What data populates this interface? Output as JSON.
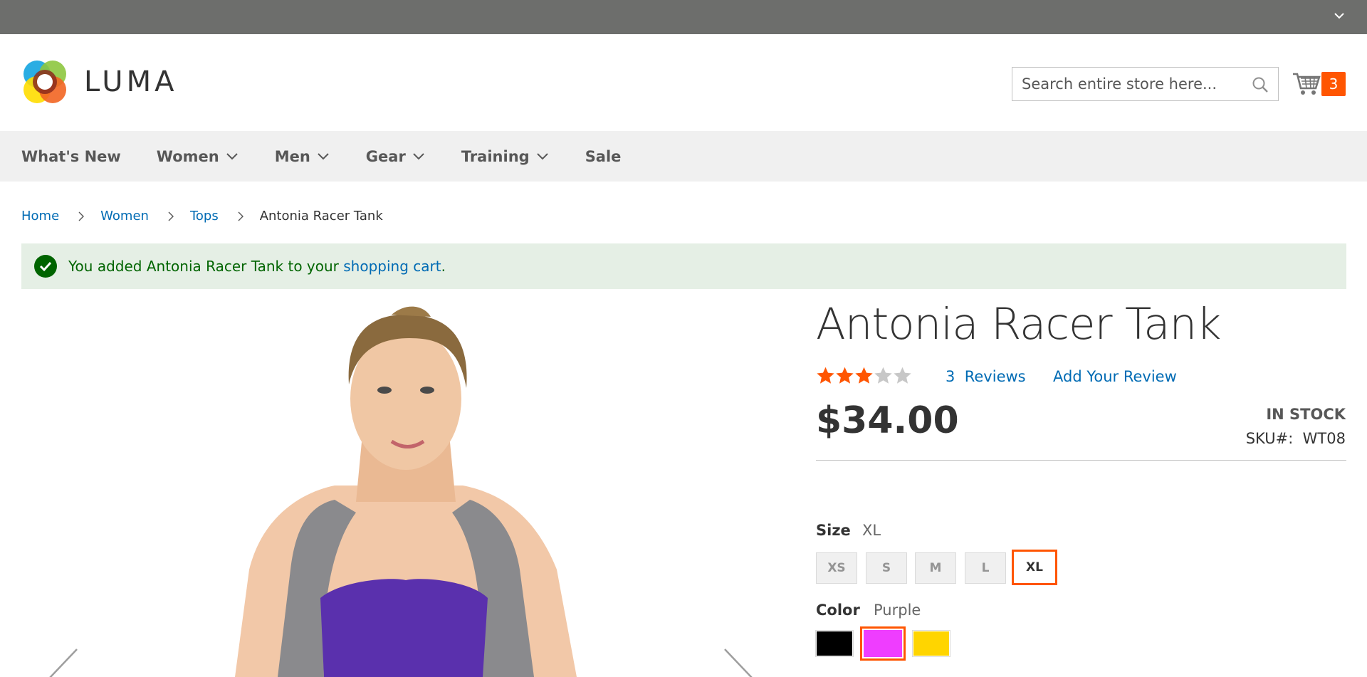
{
  "header": {
    "logo_text": "LUMA",
    "search_placeholder": "Search entire store here...",
    "cart_count": "3"
  },
  "nav": {
    "items": [
      {
        "label": "What's New",
        "has_dropdown": false
      },
      {
        "label": "Women",
        "has_dropdown": true
      },
      {
        "label": "Men",
        "has_dropdown": true
      },
      {
        "label": "Gear",
        "has_dropdown": true
      },
      {
        "label": "Training",
        "has_dropdown": true
      },
      {
        "label": "Sale",
        "has_dropdown": false
      }
    ]
  },
  "breadcrumbs": {
    "home": "Home",
    "women": "Women",
    "tops": "Tops",
    "current": "Antonia Racer Tank"
  },
  "message": {
    "prefix": "You added Antonia Racer Tank to your ",
    "link": "shopping cart",
    "suffix": "."
  },
  "product": {
    "title": "Antonia Racer Tank",
    "rating_stars": 3,
    "rating_max": 5,
    "reviews_count": "3",
    "reviews_label": "Reviews",
    "add_review": "Add Your Review",
    "price": "$34.00",
    "stock": "IN STOCK",
    "sku_label": "SKU#:",
    "sku": "WT08"
  },
  "options": {
    "size_label": "Size",
    "size_selected": "XL",
    "sizes": [
      "XS",
      "S",
      "M",
      "L",
      "XL"
    ],
    "color_label": "Color",
    "color_selected": "Purple",
    "colors": [
      {
        "name": "Black",
        "hex": "#000000"
      },
      {
        "name": "Purple",
        "hex": "#ef3dff"
      },
      {
        "name": "Yellow",
        "hex": "#ffd500"
      }
    ]
  },
  "colors": {
    "accent": "#ff5501",
    "link": "#006bb4",
    "success_bg": "#e5efe5",
    "success_text": "#006400"
  }
}
